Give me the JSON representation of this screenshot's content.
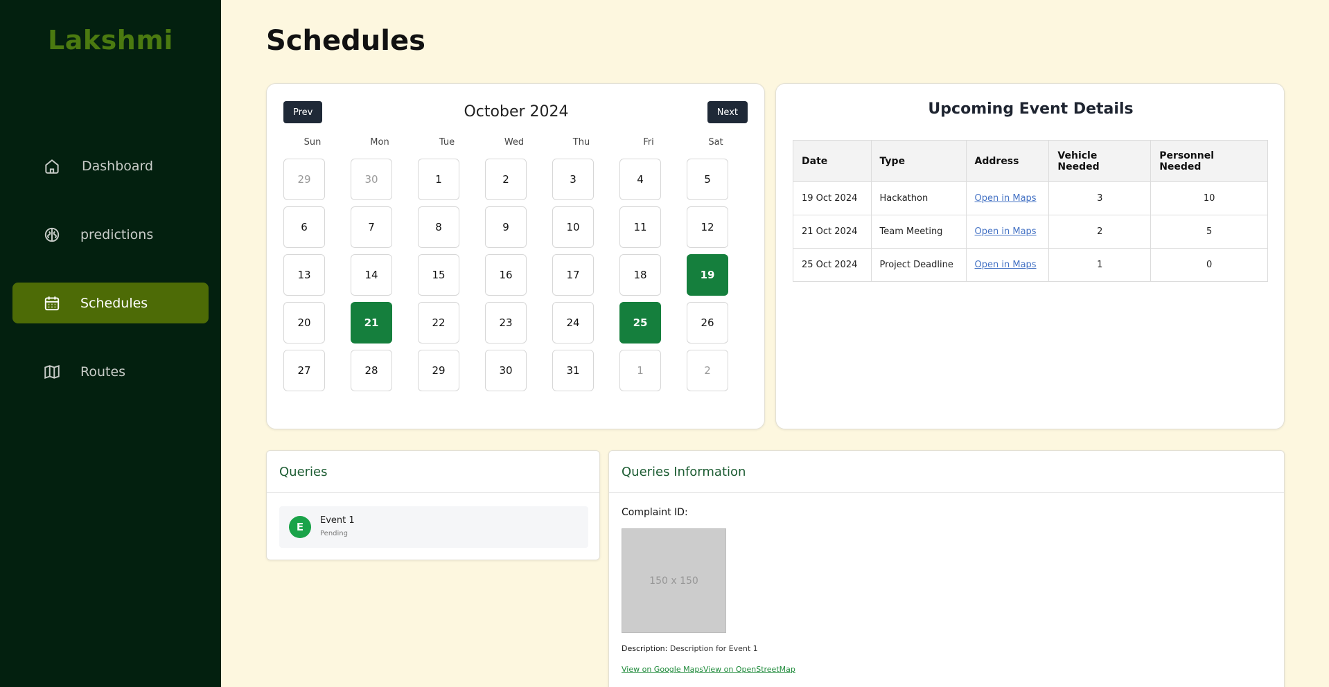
{
  "brand": "Lakshmi",
  "sidebar": {
    "items": [
      {
        "label": "Dashboard",
        "icon": "home-icon",
        "active": false
      },
      {
        "label": "predictions",
        "icon": "brain-icon",
        "active": false
      },
      {
        "label": "Schedules",
        "icon": "calendar-icon",
        "active": true
      },
      {
        "label": "Routes",
        "icon": "map-icon",
        "active": false
      }
    ]
  },
  "page_title": "Schedules",
  "calendar": {
    "prev_label": "Prev",
    "next_label": "Next",
    "month_label": "October 2024",
    "weekdays": [
      "Sun",
      "Mon",
      "Tue",
      "Wed",
      "Thu",
      "Fri",
      "Sat"
    ],
    "days": [
      {
        "d": "29",
        "muted": true
      },
      {
        "d": "30",
        "muted": true
      },
      {
        "d": "1"
      },
      {
        "d": "2"
      },
      {
        "d": "3"
      },
      {
        "d": "4"
      },
      {
        "d": "5"
      },
      {
        "d": "6"
      },
      {
        "d": "7"
      },
      {
        "d": "8"
      },
      {
        "d": "9"
      },
      {
        "d": "10"
      },
      {
        "d": "11"
      },
      {
        "d": "12"
      },
      {
        "d": "13"
      },
      {
        "d": "14"
      },
      {
        "d": "15"
      },
      {
        "d": "16"
      },
      {
        "d": "17"
      },
      {
        "d": "18"
      },
      {
        "d": "19",
        "event": true
      },
      {
        "d": "20"
      },
      {
        "d": "21",
        "event": true
      },
      {
        "d": "22"
      },
      {
        "d": "23"
      },
      {
        "d": "24"
      },
      {
        "d": "25",
        "event": true
      },
      {
        "d": "26"
      },
      {
        "d": "27"
      },
      {
        "d": "28"
      },
      {
        "d": "29"
      },
      {
        "d": "30"
      },
      {
        "d": "31"
      },
      {
        "d": "1",
        "muted": true
      },
      {
        "d": "2",
        "muted": true
      }
    ],
    "event_color": "#157f3d"
  },
  "events": {
    "title": "Upcoming Event Details",
    "columns": [
      "Date",
      "Type",
      "Address",
      "Vehicle Needed",
      "Personnel Needed"
    ],
    "rows": [
      {
        "date": "19 Oct 2024",
        "type": "Hackathon",
        "address": "Open in Maps",
        "vehicles": "3",
        "personnel": "10"
      },
      {
        "date": "21 Oct 2024",
        "type": "Team Meeting",
        "address": "Open in Maps",
        "vehicles": "2",
        "personnel": "5"
      },
      {
        "date": "25 Oct 2024",
        "type": "Project Deadline",
        "address": "Open in Maps",
        "vehicles": "1",
        "personnel": "0"
      }
    ]
  },
  "queries": {
    "title": "Queries",
    "items": [
      {
        "initial": "E",
        "name": "Event 1",
        "status": "Pending"
      }
    ]
  },
  "queries_info": {
    "title": "Queries Information",
    "complaint_label": "Complaint ID:",
    "image_placeholder": "150 x 150",
    "description_label": "Description:",
    "description_value": "Description for Event 1",
    "google_link": "View on Google Maps",
    "osm_link": "View on OpenStreetMap"
  },
  "colors": {
    "sidebar_bg": "#03200f",
    "brand": "#4b7a10",
    "active_nav": "#4d6b06",
    "page_bg": "#fdf7df",
    "event_day": "#157f3d",
    "header_text": "#1c5c32"
  }
}
